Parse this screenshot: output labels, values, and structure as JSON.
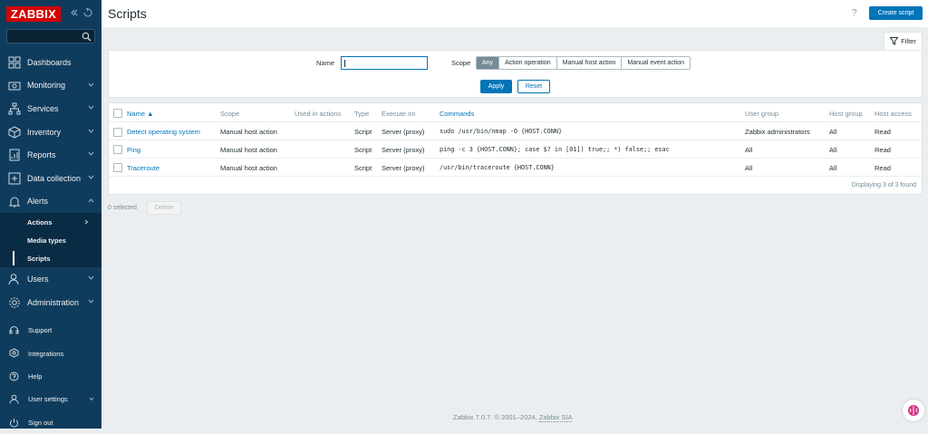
{
  "brand": {
    "logo": "ZABBIX",
    "accent": "#d40000",
    "sidebar_bg": "#0f3c5d",
    "primary": "#0275b8"
  },
  "sidebar": {
    "items": [
      {
        "label": "Dashboards",
        "icon": "dashboard-icon"
      },
      {
        "label": "Monitoring",
        "icon": "monitoring-icon"
      },
      {
        "label": "Services",
        "icon": "services-icon"
      },
      {
        "label": "Inventory",
        "icon": "inventory-icon"
      },
      {
        "label": "Reports",
        "icon": "reports-icon"
      },
      {
        "label": "Data collection",
        "icon": "data-collection-icon"
      },
      {
        "label": "Alerts",
        "icon": "bell-icon"
      }
    ],
    "submenu": [
      {
        "label": "Actions"
      },
      {
        "label": "Media types"
      },
      {
        "label": "Scripts"
      }
    ],
    "items2": [
      {
        "label": "Users",
        "icon": "users-icon"
      },
      {
        "label": "Administration",
        "icon": "gear-icon"
      }
    ],
    "bottom": [
      {
        "label": "Support",
        "icon": "headset-icon"
      },
      {
        "label": "Integrations",
        "icon": "integrations-icon"
      },
      {
        "label": "Help",
        "icon": "help-icon"
      },
      {
        "label": "User settings",
        "icon": "user-icon"
      },
      {
        "label": "Sign out",
        "icon": "power-icon"
      }
    ]
  },
  "header": {
    "title": "Scripts",
    "help": "?",
    "create_label": "Create script"
  },
  "filter": {
    "tab_label": "Filter",
    "name_label": "Name",
    "name_value": "",
    "scope_label": "Scope",
    "scope_options": [
      "Any",
      "Action operation",
      "Manual host action",
      "Manual event action"
    ],
    "scope_selected": "Any",
    "apply_label": "Apply",
    "reset_label": "Reset"
  },
  "table": {
    "columns": [
      "Name ▲",
      "Scope",
      "Used in actions",
      "Type",
      "Execute on",
      "Commands",
      "User group",
      "Host group",
      "Host access"
    ],
    "rows": [
      {
        "name": "Detect operating system",
        "scope": "Manual host action",
        "used": "",
        "type": "Script",
        "execute_on": "Server (proxy)",
        "commands": "sudo /usr/bin/nmap -O {HOST.CONN}",
        "user_group": "Zabbix administrators",
        "host_group": "All",
        "host_access": "Read"
      },
      {
        "name": "Ping",
        "scope": "Manual host action",
        "used": "",
        "type": "Script",
        "execute_on": "Server (proxy)",
        "commands": "ping -c 3 {HOST.CONN}; case $? in [01]) true;; *) false;; esac",
        "user_group": "All",
        "host_group": "All",
        "host_access": "Read"
      },
      {
        "name": "Traceroute",
        "scope": "Manual host action",
        "used": "",
        "type": "Script",
        "execute_on": "Server (proxy)",
        "commands": "/usr/bin/traceroute {HOST.CONN}",
        "user_group": "All",
        "host_group": "All",
        "host_access": "Read"
      }
    ],
    "footer": "Displaying 3 of 3 found"
  },
  "actions": {
    "selected": "0 selected",
    "delete_label": "Delete"
  },
  "footer": {
    "copyright": "Zabbix 7.0.7. © 2001–2024, ",
    "company": "Zabbix SIA"
  }
}
